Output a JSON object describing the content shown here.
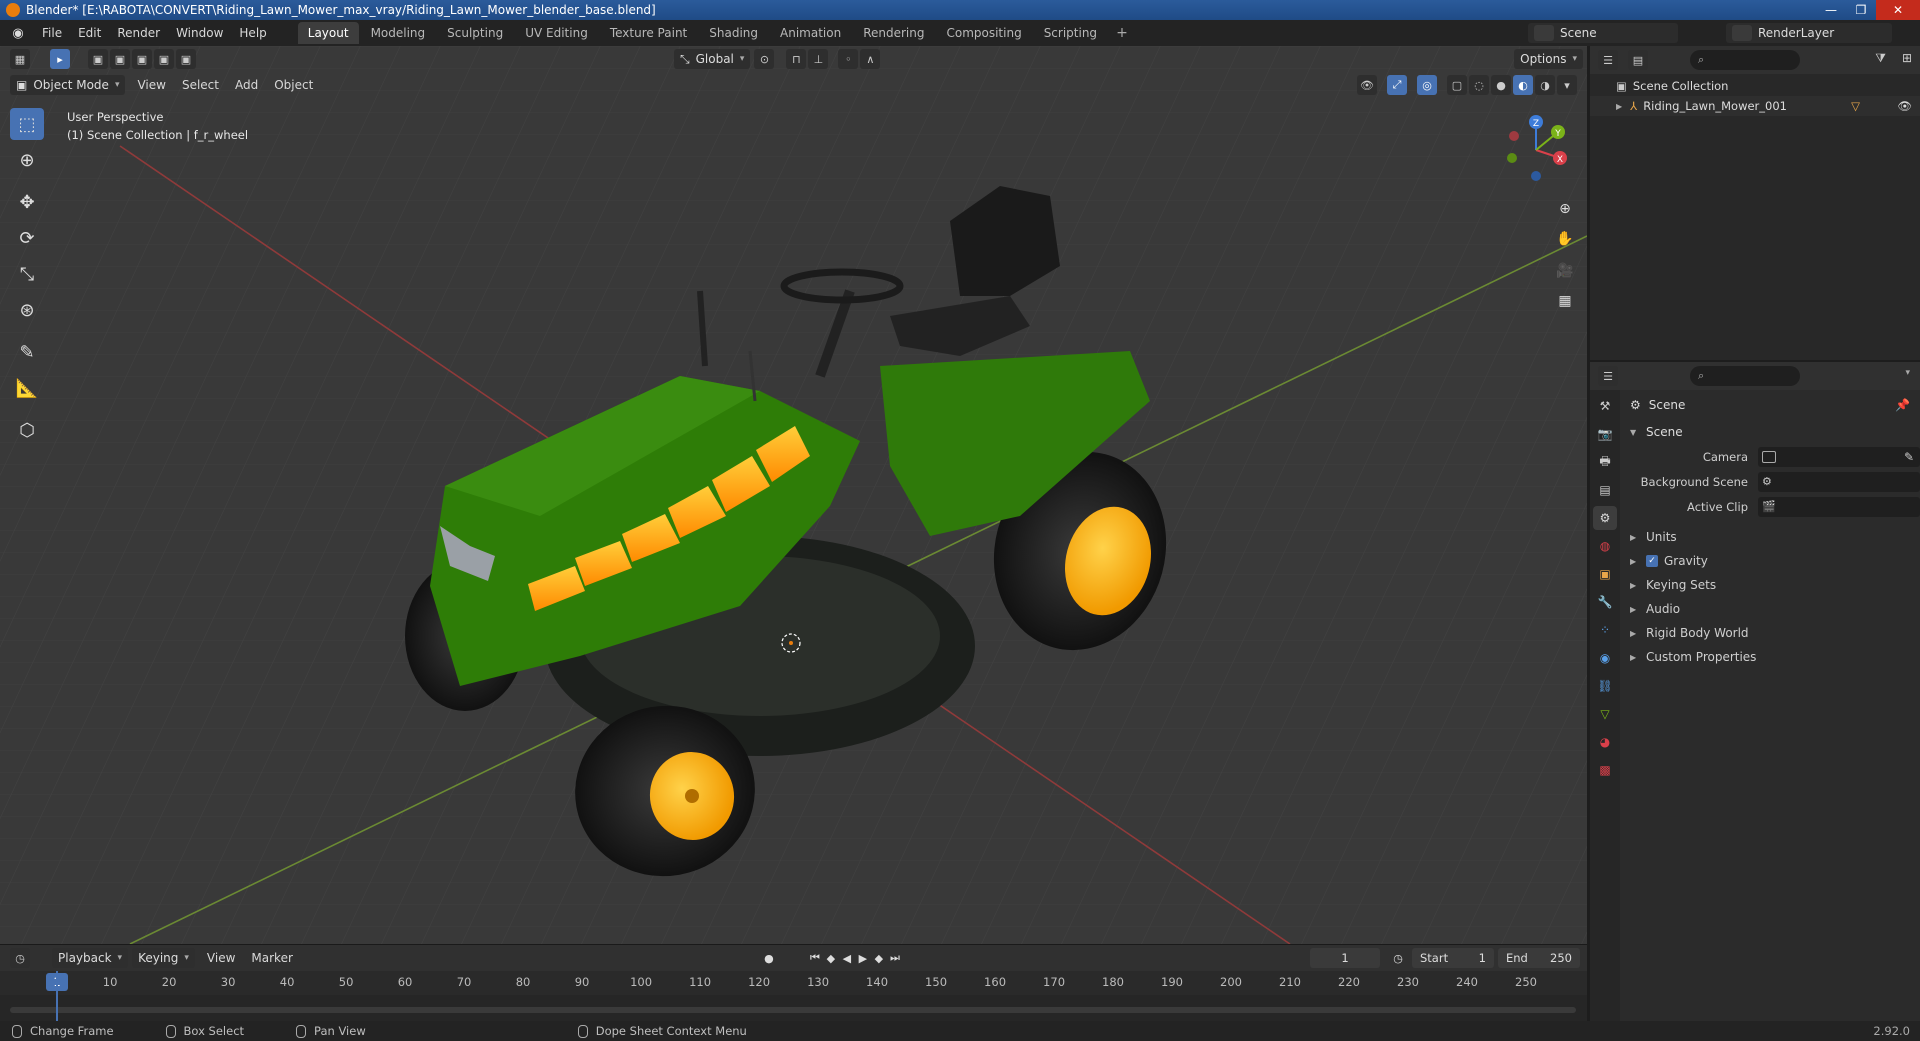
{
  "window": {
    "title": "Blender* [E:\\RABOTA\\CONVERT\\Riding_Lawn_Mower_max_vray/Riding_Lawn_Mower_blender_base.blend]"
  },
  "menu": [
    "File",
    "Edit",
    "Render",
    "Window",
    "Help"
  ],
  "workspaces": [
    "Layout",
    "Modeling",
    "Sculpting",
    "UV Editing",
    "Texture Paint",
    "Shading",
    "Animation",
    "Rendering",
    "Compositing",
    "Scripting"
  ],
  "active_workspace": "Layout",
  "scene_selector": "Scene",
  "render_layer": "RenderLayer",
  "viewport": {
    "mode": "Object Mode",
    "menus": [
      "View",
      "Select",
      "Add",
      "Object"
    ],
    "transform_orientation": "Global",
    "options_label": "Options",
    "perspective_label": "User Perspective",
    "collection_label": "(1) Scene Collection | f_r_wheel"
  },
  "outliner": {
    "root": "Scene Collection",
    "items": [
      "Riding_Lawn_Mower_001"
    ]
  },
  "properties": {
    "title": "Scene",
    "panel": "Scene",
    "fields": [
      {
        "label": "Camera"
      },
      {
        "label": "Background Scene"
      },
      {
        "label": "Active Clip"
      }
    ],
    "subpanels": [
      "Units",
      "Gravity",
      "Keying Sets",
      "Audio",
      "Rigid Body World",
      "Custom Properties"
    ],
    "gravity_checked": true
  },
  "timeline": {
    "menus": [
      "Playback",
      "Keying",
      "View",
      "Marker"
    ],
    "current_frame": "1",
    "start_label": "Start",
    "start": "1",
    "end_label": "End",
    "end": "250",
    "ticks": [
      "1",
      "10",
      "20",
      "30",
      "40",
      "50",
      "60",
      "70",
      "80",
      "90",
      "100",
      "110",
      "120",
      "130",
      "140",
      "150",
      "160",
      "170",
      "180",
      "190",
      "200",
      "210",
      "220",
      "230",
      "240",
      "250"
    ]
  },
  "statusbar": {
    "hints": [
      "Change Frame",
      "Box Select",
      "Pan View",
      "Dope Sheet Context Menu"
    ],
    "version": "2.92.0"
  }
}
